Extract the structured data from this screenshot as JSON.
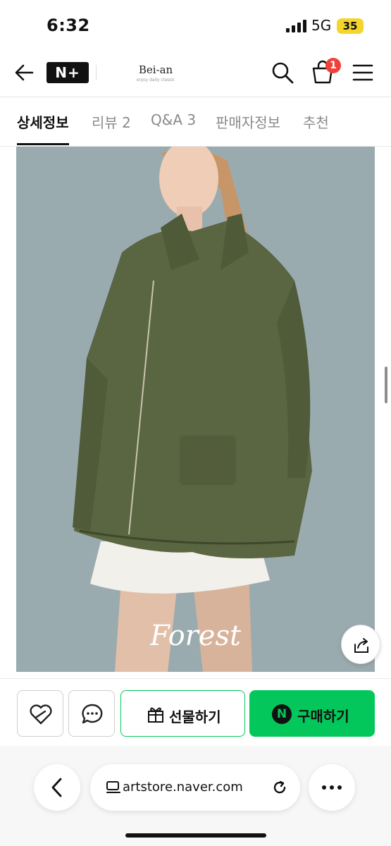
{
  "status_bar": {
    "time": "6:32",
    "network": "5G",
    "battery": "35"
  },
  "header": {
    "logo_text": "N+",
    "brand_name": "Bei-an",
    "brand_tagline": "enjoy daily classic",
    "cart_count": "1",
    "icons": [
      "back-arrow-icon",
      "search-icon",
      "shopping-bag-icon",
      "hamburger-menu-icon"
    ]
  },
  "tabs": [
    {
      "label": "상세정보",
      "active": true
    },
    {
      "label": "리뷰 2",
      "active": false
    },
    {
      "label": "Q&A 3",
      "active": false
    },
    {
      "label": "판매자정보",
      "active": false
    },
    {
      "label": "추천",
      "active": false
    }
  ],
  "hero": {
    "overlay_text": "Forest",
    "description_colors": {
      "background": "#9aabb0",
      "jacket": "#5a6541"
    }
  },
  "actions": {
    "gift_label": "선물하기",
    "buy_label": "구매하기",
    "buy_badge": "N"
  },
  "browser": {
    "url": "artstore.naver.com"
  },
  "colors": {
    "accent_green": "#03c75a",
    "badge_red": "#f0413b",
    "battery_yellow": "#f6d52b"
  }
}
